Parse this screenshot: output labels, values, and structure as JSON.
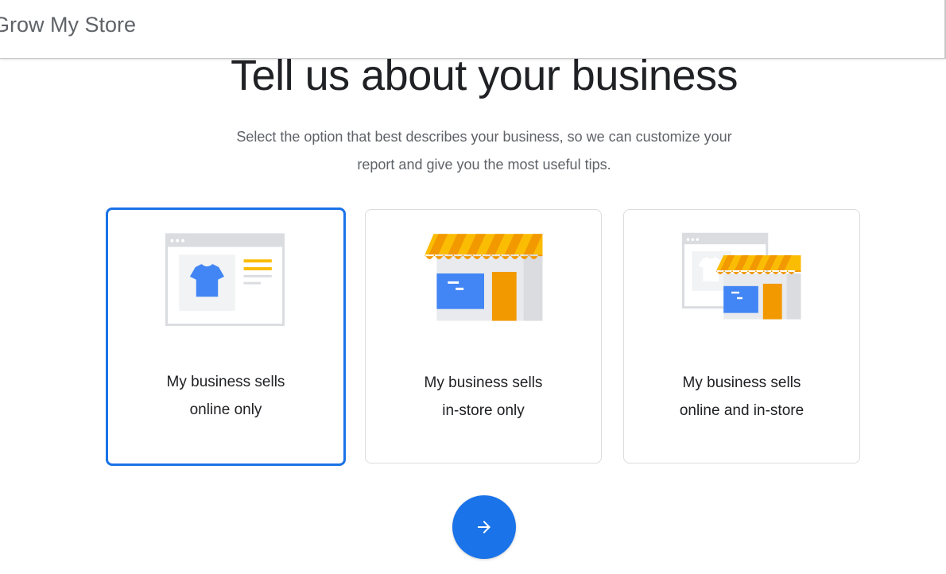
{
  "header": {
    "brand": "Grow My Store"
  },
  "main": {
    "title": "Tell us about your business",
    "subtitle_line1": "Select the option that best describes your business, so we can customize your",
    "subtitle_line2": "report and give you the most useful tips."
  },
  "options": [
    {
      "line1": "My business sells",
      "line2": "online only",
      "icon": "online-store-icon",
      "selected": true
    },
    {
      "line1": "My business sells",
      "line2": "in-store only",
      "icon": "storefront-icon",
      "selected": false
    },
    {
      "line1": "My business sells",
      "line2": "online and in-store",
      "icon": "online-and-storefront-icon",
      "selected": false
    }
  ],
  "next_button": {
    "icon": "arrow-right-icon"
  },
  "colors": {
    "accent": "#1a73e8",
    "awning_yellow": "#fbbc04",
    "awning_orange": "#f29900",
    "door_orange": "#f29900",
    "window_blue": "#4285f4",
    "frame_gray": "#dadce0"
  }
}
